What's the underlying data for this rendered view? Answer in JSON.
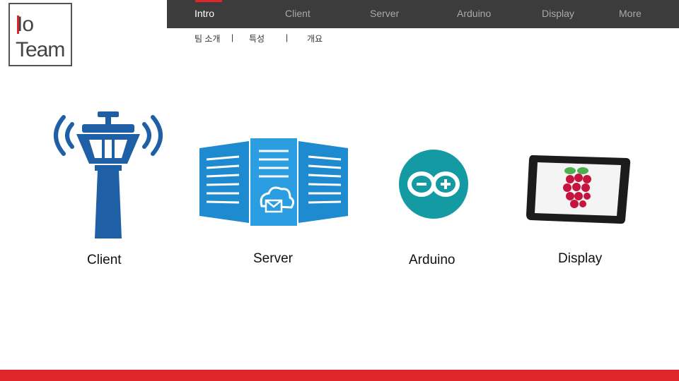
{
  "logo": {
    "line1": "Io",
    "line2": "Team"
  },
  "nav": {
    "items": [
      {
        "label": "Intro",
        "active": true
      },
      {
        "label": "Client",
        "active": false
      },
      {
        "label": "Server",
        "active": false
      },
      {
        "label": "Arduino",
        "active": false
      },
      {
        "label": "Display",
        "active": false
      },
      {
        "label": "More",
        "active": false
      }
    ]
  },
  "subnav": {
    "items": [
      "팀 소개",
      "특성",
      "개요"
    ],
    "separator": "|"
  },
  "cards": [
    {
      "label": "Client",
      "icon": "control-tower-icon"
    },
    {
      "label": "Server",
      "icon": "server-cloud-icon"
    },
    {
      "label": "Arduino",
      "icon": "arduino-icon"
    },
    {
      "label": "Display",
      "icon": "raspberry-pi-tablet-icon"
    }
  ],
  "colors": {
    "accent": "#e0262b",
    "nav_bg": "#3c3c3c",
    "tower_blue": "#1f5fa6",
    "server_blue": "#1e8bd0",
    "arduino_teal": "#139aa3"
  }
}
